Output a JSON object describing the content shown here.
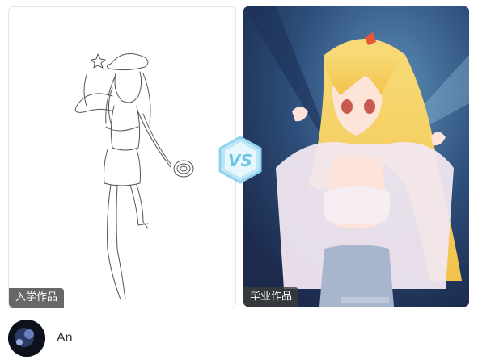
{
  "comparison": {
    "before_label": "入学作品",
    "after_label": "毕业作品",
    "vs_badge": "VS"
  },
  "author": {
    "name": "An"
  },
  "colors": {
    "vs_badge": "#8fd3ee",
    "after_bg": "#3b4a6d",
    "hair": "#f6d56a"
  }
}
